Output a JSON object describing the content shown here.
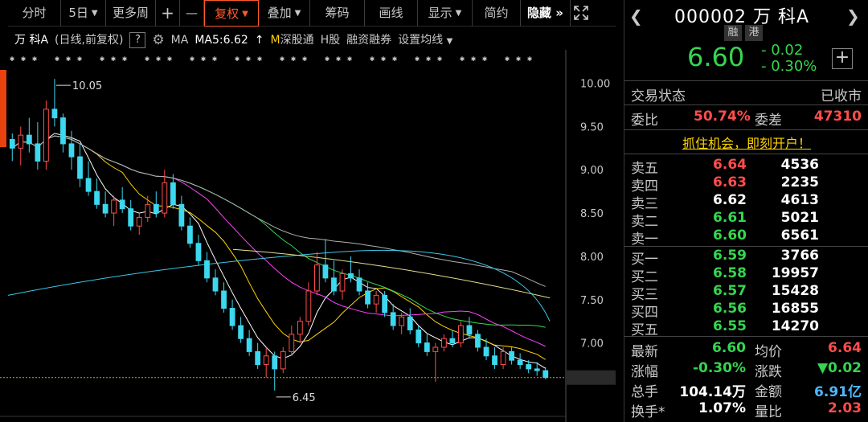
{
  "toolbar": {
    "items": [
      "分时",
      "5日",
      "更多周",
      "+",
      "—",
      "复权",
      "叠加",
      "筹码",
      "画线",
      "显示",
      "简约",
      "隐藏 »"
    ]
  },
  "info": {
    "stock": "万 科A",
    "period": "(日线,前复权)",
    "question": "?",
    "ma_label": "MA",
    "ma5": "MA5:6.62",
    "arrow": "↑",
    "ml_icon": "M",
    "links": [
      "深股通",
      "H股",
      "融资融券"
    ],
    "ma_setting": "设置均线"
  },
  "chart_data": {
    "type": "candlestick",
    "y_ticks": [
      "10.00",
      "9.50",
      "9.00",
      "8.50",
      "8.00",
      "7.50",
      "7.00",
      "6.60"
    ],
    "ylim": [
      6.3,
      10.2
    ],
    "current_price": 6.6,
    "high_marker": "10.05",
    "low_marker": "6.45",
    "candles": [
      [
        9.35,
        9.42,
        9.1,
        9.25
      ],
      [
        9.25,
        9.5,
        9.05,
        9.4
      ],
      [
        9.4,
        9.6,
        9.2,
        9.3
      ],
      [
        9.3,
        9.55,
        9.0,
        9.1
      ],
      [
        9.1,
        9.8,
        9.0,
        9.7
      ],
      [
        9.7,
        10.05,
        9.5,
        9.6
      ],
      [
        9.6,
        9.65,
        9.2,
        9.3
      ],
      [
        9.3,
        9.45,
        9.0,
        9.15
      ],
      [
        9.15,
        9.3,
        8.8,
        8.9
      ],
      [
        8.9,
        9.1,
        8.7,
        8.75
      ],
      [
        8.75,
        8.9,
        8.55,
        8.6
      ],
      [
        8.6,
        8.75,
        8.45,
        8.5
      ],
      [
        8.5,
        8.7,
        8.35,
        8.65
      ],
      [
        8.65,
        8.8,
        8.5,
        8.55
      ],
      [
        8.55,
        8.65,
        8.3,
        8.35
      ],
      [
        8.35,
        8.5,
        8.25,
        8.45
      ],
      [
        8.45,
        8.7,
        8.4,
        8.6
      ],
      [
        8.6,
        8.75,
        8.45,
        8.5
      ],
      [
        8.5,
        9.0,
        8.45,
        8.85
      ],
      [
        8.85,
        8.95,
        8.55,
        8.6
      ],
      [
        8.6,
        8.7,
        8.3,
        8.35
      ],
      [
        8.35,
        8.45,
        8.1,
        8.15
      ],
      [
        8.15,
        8.25,
        7.9,
        7.95
      ],
      [
        7.95,
        8.05,
        7.7,
        7.75
      ],
      [
        7.75,
        7.85,
        7.55,
        7.6
      ],
      [
        7.6,
        7.7,
        7.35,
        7.4
      ],
      [
        7.4,
        7.5,
        7.15,
        7.2
      ],
      [
        7.2,
        7.3,
        7.0,
        7.05
      ],
      [
        7.05,
        7.15,
        6.85,
        6.9
      ],
      [
        6.9,
        7.0,
        6.7,
        6.75
      ],
      [
        6.75,
        6.95,
        6.6,
        6.85
      ],
      [
        6.85,
        6.9,
        6.45,
        6.7
      ],
      [
        6.7,
        6.95,
        6.65,
        6.9
      ],
      [
        6.9,
        7.2,
        6.85,
        7.1
      ],
      [
        7.1,
        7.3,
        7.0,
        7.25
      ],
      [
        7.25,
        7.7,
        7.2,
        7.6
      ],
      [
        7.6,
        8.05,
        7.55,
        7.9
      ],
      [
        7.9,
        8.2,
        7.7,
        7.75
      ],
      [
        7.75,
        7.95,
        7.55,
        7.6
      ],
      [
        7.6,
        7.85,
        7.5,
        7.8
      ],
      [
        7.8,
        8.0,
        7.7,
        7.75
      ],
      [
        7.75,
        7.85,
        7.55,
        7.6
      ],
      [
        7.6,
        7.7,
        7.4,
        7.45
      ],
      [
        7.45,
        7.6,
        7.35,
        7.55
      ],
      [
        7.55,
        7.6,
        7.3,
        7.35
      ],
      [
        7.35,
        7.45,
        7.15,
        7.2
      ],
      [
        7.2,
        7.35,
        7.1,
        7.3
      ],
      [
        7.3,
        7.4,
        7.1,
        7.15
      ],
      [
        7.15,
        7.2,
        6.95,
        7.0
      ],
      [
        7.0,
        7.1,
        6.85,
        6.9
      ],
      [
        6.9,
        7.0,
        6.55,
        6.95
      ],
      [
        6.95,
        7.1,
        6.9,
        7.05
      ],
      [
        7.05,
        7.15,
        6.95,
        7.0
      ],
      [
        7.0,
        7.25,
        6.95,
        7.2
      ],
      [
        7.2,
        7.3,
        7.05,
        7.1
      ],
      [
        7.1,
        7.15,
        6.9,
        6.95
      ],
      [
        6.95,
        7.05,
        6.8,
        6.85
      ],
      [
        6.85,
        6.95,
        6.7,
        6.75
      ],
      [
        6.75,
        6.95,
        6.7,
        6.9
      ],
      [
        6.9,
        6.95,
        6.75,
        6.8
      ],
      [
        6.8,
        6.88,
        6.7,
        6.75
      ],
      [
        6.75,
        6.8,
        6.65,
        6.7
      ],
      [
        6.7,
        6.78,
        6.62,
        6.68
      ],
      [
        6.68,
        6.72,
        6.58,
        6.6
      ]
    ]
  },
  "quote": {
    "prev_arrow": "❮",
    "next_arrow": "❯",
    "code": "000002 万 科A",
    "tags": [
      "融",
      "港"
    ],
    "price": "6.60",
    "change": "- 0.02",
    "change_pct": "- 0.30%",
    "plus": "+",
    "trade_state_label": "交易状态",
    "trade_state": "已收市",
    "weibi_label": "委比",
    "weibi": "50.74%",
    "weicha_label": "委差",
    "weicha": "47310",
    "promo": "抓住机会，即刻开户！"
  },
  "sell": [
    {
      "label": "卖五",
      "price": "6.64",
      "vol": "4536",
      "color": "red"
    },
    {
      "label": "卖四",
      "price": "6.63",
      "vol": "2235",
      "color": "red"
    },
    {
      "label": "卖三",
      "price": "6.62",
      "vol": "4613",
      "color": "white"
    },
    {
      "label": "卖二",
      "price": "6.61",
      "vol": "5021",
      "color": "green"
    },
    {
      "label": "卖一",
      "price": "6.60",
      "vol": "6561",
      "color": "green"
    }
  ],
  "buy": [
    {
      "label": "买一",
      "price": "6.59",
      "vol": "3766",
      "color": "green"
    },
    {
      "label": "买二",
      "price": "6.58",
      "vol": "19957",
      "color": "green"
    },
    {
      "label": "买三",
      "price": "6.57",
      "vol": "15428",
      "color": "green"
    },
    {
      "label": "买四",
      "price": "6.56",
      "vol": "16855",
      "color": "green"
    },
    {
      "label": "买五",
      "price": "6.55",
      "vol": "14270",
      "color": "green"
    }
  ],
  "stats": {
    "latest_label": "最新",
    "latest": "6.60",
    "avg_label": "均价",
    "avg": "6.64",
    "pct_label": "涨幅",
    "pct": "-0.30%",
    "chg_label": "涨跌",
    "chg": "▼0.02",
    "vol_label": "总手",
    "vol": "104.14万",
    "amt_label": "金额",
    "amt": "6.91亿",
    "turn_label": "换手*",
    "turn": "1.07%",
    "ratio_label": "量比",
    "ratio": "2.03"
  }
}
